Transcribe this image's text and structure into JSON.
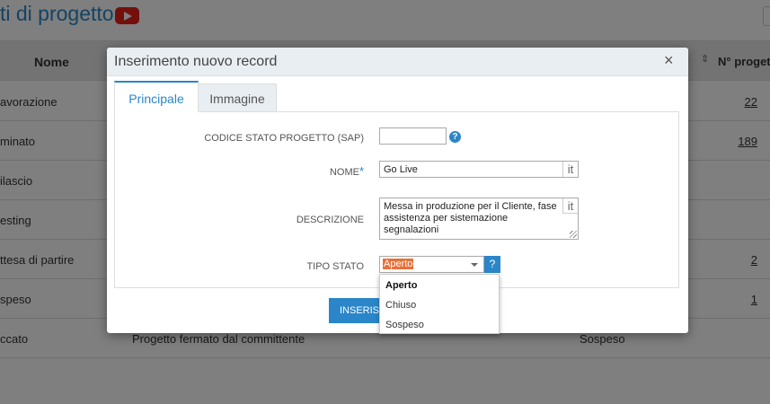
{
  "page": {
    "title": "ti di progetto",
    "table": {
      "header_nome": "Nome",
      "header_count": "N° progetti",
      "sort_icon": "⇕",
      "rows": [
        {
          "nome": "avorazione",
          "descrizione": "",
          "tipo": "",
          "count": "22"
        },
        {
          "nome": "minato",
          "descrizione": "",
          "tipo": "",
          "count": "189"
        },
        {
          "nome": "ilascio",
          "descrizione": "",
          "tipo": "",
          "count": ""
        },
        {
          "nome": "esting",
          "descrizione": "",
          "tipo": "",
          "count": ""
        },
        {
          "nome": "ttesa di partire",
          "descrizione": "",
          "tipo": "",
          "count": "2"
        },
        {
          "nome": "speso",
          "descrizione": "",
          "tipo": "",
          "count": "1"
        },
        {
          "nome": "ccato",
          "descrizione": "Progetto fermato dal committente",
          "tipo": "Sospeso",
          "count": ""
        }
      ]
    }
  },
  "modal": {
    "title": "Inserimento nuovo record",
    "close": "×",
    "tabs": [
      "Principale",
      "Immagine"
    ],
    "fields": {
      "codice": {
        "label": "CODICE STATO PROGETTO (SAP)",
        "value": "",
        "help": "?"
      },
      "nome": {
        "label": "NOME",
        "required": "*",
        "value": "Go Live",
        "lang": "it"
      },
      "descrizione": {
        "label": "DESCRIZIONE",
        "value": "Messa in produzione per il Cliente, fase assistenza per sistemazione segnalazioni",
        "lang": "it"
      },
      "tipo_stato": {
        "label": "TIPO STATO",
        "value": "Aperto",
        "help": "?"
      }
    },
    "insert_button": "INSERISCI"
  },
  "dropdown": {
    "options": [
      "Aperto",
      "Chiuso",
      "Sospeso"
    ],
    "selected": "Aperto"
  },
  "colors": {
    "accent": "#2a86c9",
    "highlight": "#e8703a",
    "youtube": "#e62117"
  }
}
